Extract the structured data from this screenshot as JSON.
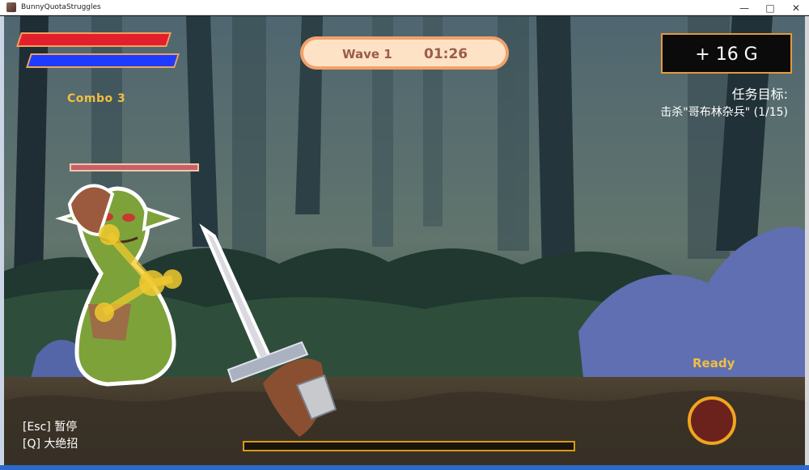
{
  "window": {
    "title": "BunnyQuotaStruggles",
    "controls": [
      "—",
      "□",
      "✕"
    ],
    "icon": "game-app-icon"
  },
  "hud": {
    "combo": "Combo 3",
    "wave": "Wave 1",
    "timer": "01:26",
    "gold": "+ 16 G",
    "quest_title": "任务目标:",
    "quest_text": "击杀\"哥布林杂兵\" (1/15)",
    "ready": "Ready",
    "controls": [
      "[Esc] 暂停",
      "[Q] 大绝招"
    ]
  },
  "colors": {
    "health": "#e31f2d",
    "mana": "#1e3cff",
    "accent": "#f0bf43",
    "wave_pill": "#fde2c6",
    "wave_text": "#9b5d48"
  },
  "enemy": {
    "name_icon": "goblin-icon",
    "health_icon": "enemy-health-icon"
  },
  "skill": {
    "icon": "fire-skill-icon",
    "status": "Ready"
  },
  "progress": {
    "value": 0
  }
}
